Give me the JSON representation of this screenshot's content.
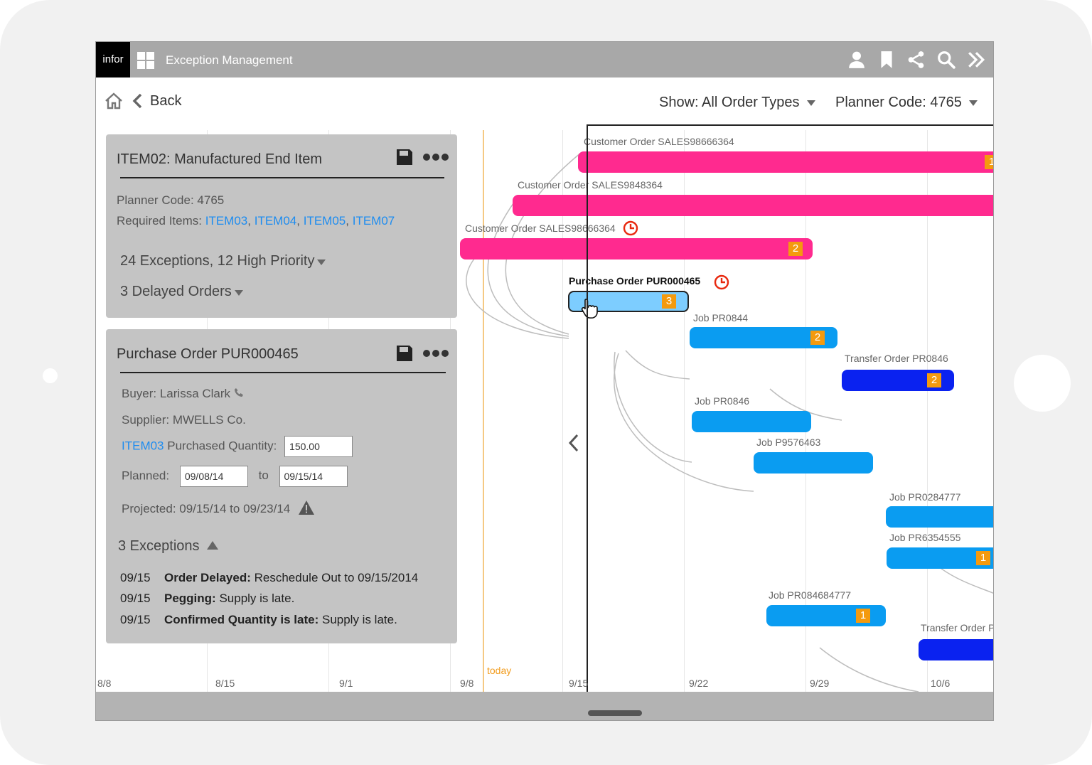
{
  "header": {
    "logo": "infor",
    "app_title": "Exception Management",
    "icons": [
      "user-icon",
      "bookmark-icon",
      "share-icon",
      "search-icon",
      "double-chevron-icon"
    ]
  },
  "nav": {
    "back_label": "Back",
    "show_filter": "Show: All Order Types",
    "planner_filter": "Planner Code: 4765"
  },
  "item_panel": {
    "title": "ITEM02: Manufactured End Item",
    "planner_code": "Planner Code: 4765",
    "required_label": "Required Items:",
    "required_items": [
      "ITEM03",
      "ITEM04",
      "ITEM05",
      "ITEM07"
    ],
    "separator": ",",
    "exceptions_summary": "24 Exceptions, 12 High Priority",
    "delayed_orders": "3 Delayed Orders"
  },
  "order_panel": {
    "title": "Purchase Order PUR000465",
    "buyer": "Buyer: Larissa Clark",
    "supplier": "Supplier: MWELLS Co.",
    "item_link": "ITEM03",
    "quantity_label": "Purchased Quantity:",
    "quantity_value": "150.00",
    "planned_label": "Planned:",
    "planned_from": "09/08/14",
    "to_label": "to",
    "planned_to": "09/15/14",
    "projected": "Projected: 09/15/14 to 09/23/14",
    "exceptions_title": "3 Exceptions",
    "exceptions": [
      {
        "date": "09/15",
        "type": "Order Delayed:",
        "detail": "Reschedule Out to 09/15/2014"
      },
      {
        "date": "09/15",
        "type": "Pegging:",
        "detail": "Supply is late."
      },
      {
        "date": "09/15",
        "type": "Confirmed Quantity is late:",
        "detail": "Supply is late."
      }
    ]
  },
  "timeline": {
    "today_label": "today",
    "dates": [
      "8/8",
      "8/15",
      "9/1",
      "9/8",
      "9/15",
      "9/22",
      "9/29",
      "10/6"
    ],
    "bars": [
      {
        "label": "Customer Order SALES98666364",
        "color": "#ff2a8f",
        "badge": "1"
      },
      {
        "label": "Customer Order SALES9848364",
        "color": "#ff2a8f",
        "badge": ""
      },
      {
        "label": "Customer Order SALES98666364",
        "color": "#ff2a8f",
        "badge": "2"
      },
      {
        "label": "Purchase Order PUR000465",
        "color": "#7dcdff",
        "badge": "3"
      },
      {
        "label": "Job PR0844",
        "color": "#0a9cf1",
        "badge": "2"
      },
      {
        "label": "Transfer Order PR0846",
        "color": "#0a22f0",
        "badge": "2"
      },
      {
        "label": "Job PR0846",
        "color": "#0a9cf1",
        "badge": ""
      },
      {
        "label": "Job P9576463",
        "color": "#0a9cf1",
        "badge": ""
      },
      {
        "label": "Job PR0284777",
        "color": "#0a9cf1",
        "badge": ""
      },
      {
        "label": "Job PR6354555",
        "color": "#0a9cf1",
        "badge": "1"
      },
      {
        "label": "Job PR084684777",
        "color": "#0a9cf1",
        "badge": "1"
      },
      {
        "label": "Transfer Order P",
        "color": "#0a22f0",
        "badge": ""
      }
    ]
  }
}
